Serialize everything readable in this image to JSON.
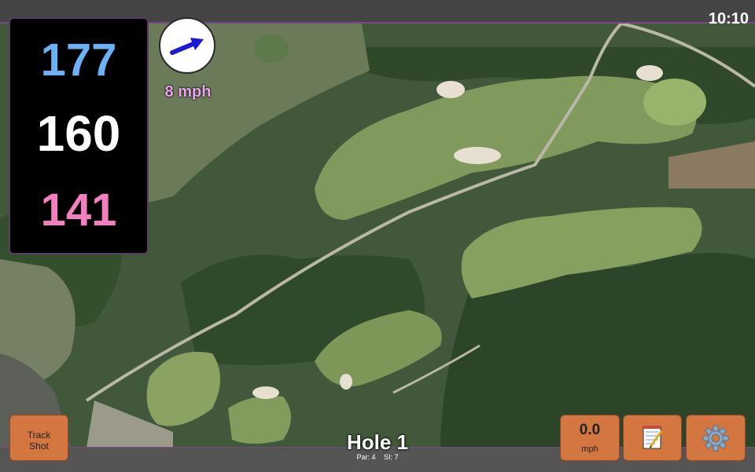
{
  "status": {
    "time": "10:10"
  },
  "distances": {
    "back": "177",
    "middle": "160",
    "front": "141"
  },
  "wind": {
    "speed_label": "8 mph",
    "arrow_icon": "arrow-right-icon",
    "arrow_color": "#1a1ad8"
  },
  "buttons": {
    "track_shot_line1": "Track",
    "track_shot_line2": "Shot",
    "wind_speed_value": "0.0",
    "wind_speed_unit": "mph",
    "notes_icon": "notepad-icon",
    "settings_icon": "gear-icon"
  },
  "hole": {
    "title": "Hole 1",
    "par_label": "Par: 4",
    "si_label": "SI: 7"
  },
  "colors": {
    "back": "#6ab2f5",
    "middle": "#ffffff",
    "front": "#f47fc0",
    "button": "#d4763f",
    "wind_text": "#e6a6ec"
  }
}
